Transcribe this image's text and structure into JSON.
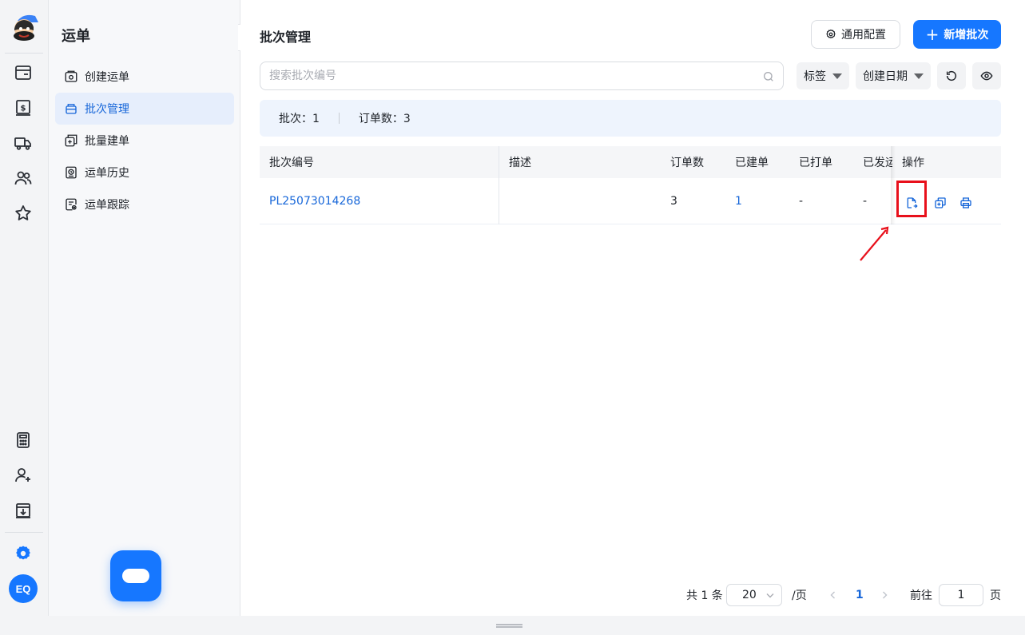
{
  "rail": {
    "icons": [
      "logo-icon",
      "wallet-icon",
      "dollar-bill-icon",
      "truck-icon",
      "users-icon",
      "star-icon",
      "calculator-icon",
      "user-add-icon",
      "download-box-icon",
      "settings-icon"
    ],
    "avatar": "EQ",
    "accent": "#1677ff"
  },
  "subnav": {
    "title": "运单",
    "items": [
      {
        "label": "创建运单",
        "icon": "box-plus-icon",
        "active": false
      },
      {
        "label": "批次管理",
        "icon": "layers-icon",
        "active": true
      },
      {
        "label": "批量建单",
        "icon": "stack-add-icon",
        "active": false
      },
      {
        "label": "运单历史",
        "icon": "history-icon",
        "active": false
      },
      {
        "label": "运单跟踪",
        "icon": "track-doc-icon",
        "active": false
      }
    ]
  },
  "header": {
    "title": "批次管理",
    "config_label": "通用配置",
    "new_label": "新增批次"
  },
  "filters": {
    "search_placeholder": "搜索批次编号",
    "tag_label": "标签",
    "date_label": "创建日期"
  },
  "summary": {
    "batches": "批次：1",
    "orders": "订单数：3"
  },
  "table": {
    "columns": [
      "批次编号",
      "描述",
      "订单数",
      "已建单",
      "已打单",
      "已发运",
      "操作"
    ],
    "rows": [
      {
        "batch_no": "PL25073014268",
        "desc": "",
        "orders": "3",
        "created": "1",
        "printed": "-",
        "shipped": "-"
      }
    ]
  },
  "pager": {
    "total": "共 1 条",
    "page_size": "20",
    "per_page": "/页",
    "current": "1",
    "goto": "前往",
    "goto_value": "1",
    "page_unit": "页"
  },
  "colors": {
    "primary": "#1677ff",
    "link": "#1666d9",
    "highlight": "#e8101b"
  }
}
